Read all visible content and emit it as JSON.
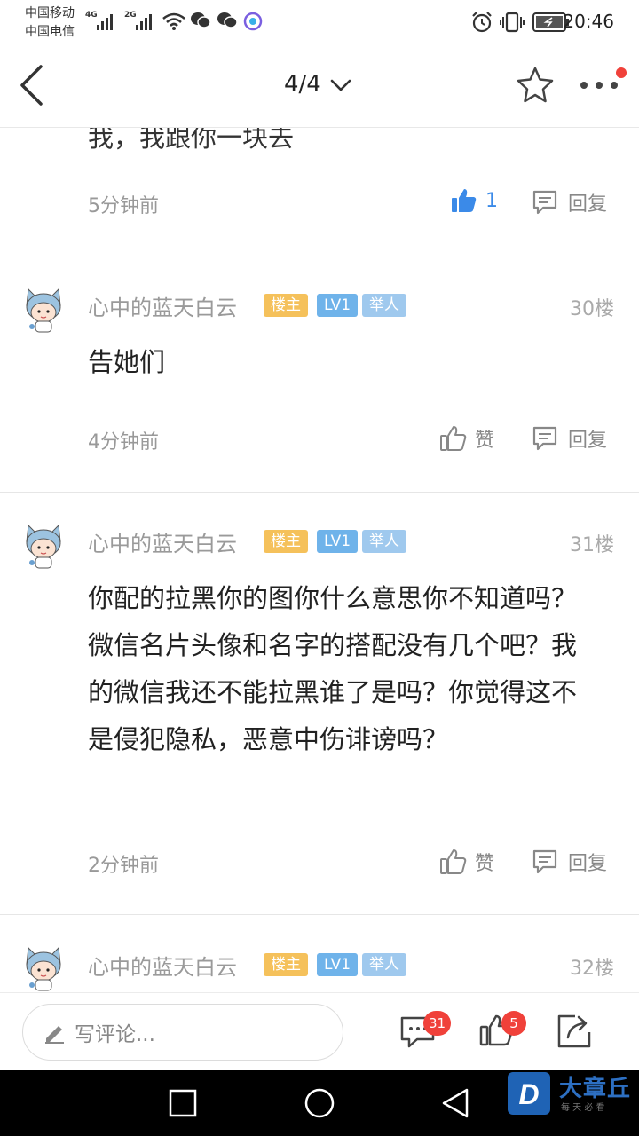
{
  "status_bar": {
    "carrier1": "中国移动",
    "carrier2": "中国电信",
    "net1": "4G",
    "net2": "2G",
    "time": "20:46"
  },
  "header": {
    "page_indicator": "4/4"
  },
  "comments": [
    {
      "partial_text": "我，我跟你一块去",
      "time": "5分钟前",
      "like_count": "1",
      "reply_label": "回复"
    },
    {
      "user": "心中的蓝天白云",
      "badges": [
        "楼主",
        "LV1",
        "举人"
      ],
      "floor": "30楼",
      "text": "告她们",
      "time": "4分钟前",
      "like_label": "赞",
      "reply_label": "回复"
    },
    {
      "user": "心中的蓝天白云",
      "badges": [
        "楼主",
        "LV1",
        "举人"
      ],
      "floor": "31楼",
      "text": "你配的拉黑你的图你什么意思你不知道吗？微信名片头像和名字的搭配没有几个吧？我的微信我还不能拉黑谁了是吗？你觉得这不是侵犯隐私，恶意中伤诽谤吗？",
      "time": "2分钟前",
      "like_label": "赞",
      "reply_label": "回复"
    },
    {
      "user": "心中的蓝天白云",
      "badges": [
        "楼主",
        "LV1",
        "举人"
      ],
      "floor": "32楼"
    }
  ],
  "bottom_bar": {
    "comment_placeholder": "写评论...",
    "comment_count": "31",
    "like_count": "5"
  },
  "watermark": {
    "logo_letter": "D",
    "brand": "大章丘",
    "slogan": "每 天 必 看"
  },
  "colors": {
    "accent_blue": "#3b8ae8",
    "owner_badge": "#f5c15b",
    "level_badge": "#6fb3ea",
    "notify_red": "#f0413a"
  },
  "icons": [
    "back-icon",
    "chevron-down-icon",
    "star-icon",
    "more-icon",
    "thumb-up-icon",
    "reply-icon",
    "pencil-icon",
    "comment-icon",
    "share-icon",
    "nav-square-icon",
    "nav-circle-icon",
    "nav-back-icon"
  ]
}
